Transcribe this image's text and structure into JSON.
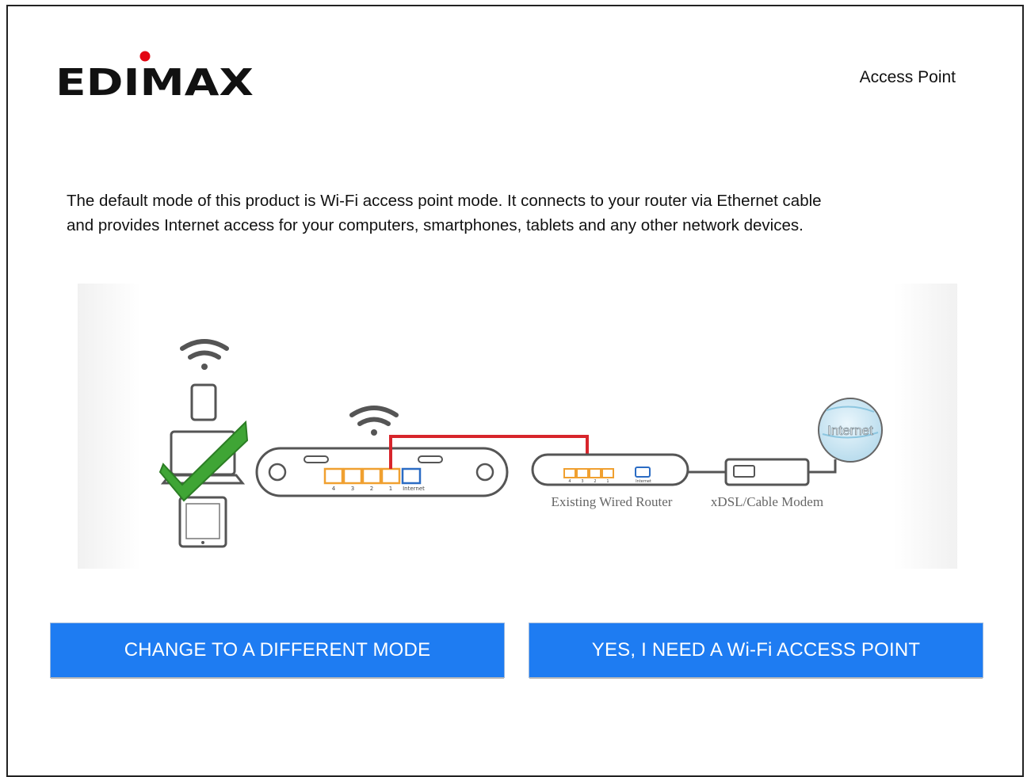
{
  "header": {
    "brand": "EDIMAX",
    "mode_label": "Access Point"
  },
  "description": {
    "line1": "The default mode of this product is Wi-Fi access point mode. It connects to your router via Ethernet cable",
    "line2": "and provides Internet access for your computers, smartphones, tablets and any other network devices."
  },
  "diagram": {
    "ports_ap": [
      "4",
      "3",
      "2",
      "1",
      "Internet"
    ],
    "ports_router": [
      "4",
      "3",
      "2",
      "1",
      "Internet"
    ],
    "router_label": "Existing Wired Router",
    "modem_label": "xDSL/Cable Modem",
    "globe_label": "Internet"
  },
  "actions": {
    "change_mode": "CHANGE TO A DIFFERENT MODE",
    "confirm": "YES, I NEED A Wi-Fi ACCESS POINT"
  },
  "colors": {
    "button": "#1e7cf2",
    "logo_dot": "#e30613",
    "cable": "#d7252b",
    "port_orange": "#f0a030",
    "port_blue": "#2b6cc4",
    "check": "#3fa535"
  }
}
